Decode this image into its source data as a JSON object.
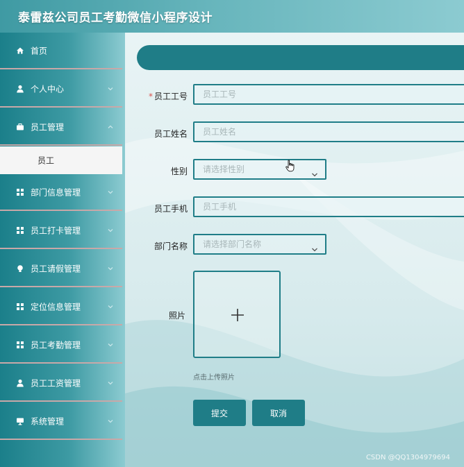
{
  "app": {
    "title": "泰雷兹公司员工考勤微信小程序设计"
  },
  "sidebar": {
    "items": [
      {
        "label": "首页",
        "icon": "home-icon"
      },
      {
        "label": "个人中心",
        "icon": "user-icon"
      },
      {
        "label": "员工管理",
        "icon": "briefcase-icon"
      },
      {
        "label": "部门信息管理",
        "icon": "grid-icon"
      },
      {
        "label": "员工打卡管理",
        "icon": "grid-icon"
      },
      {
        "label": "员工请假管理",
        "icon": "bulb-icon"
      },
      {
        "label": "定位信息管理",
        "icon": "grid-icon"
      },
      {
        "label": "员工考勤管理",
        "icon": "grid-icon"
      },
      {
        "label": "员工工资管理",
        "icon": "user-icon"
      },
      {
        "label": "系统管理",
        "icon": "monitor-icon"
      }
    ],
    "active_submenu": {
      "label": "员工"
    }
  },
  "form": {
    "employee_no": {
      "label": "员工工号",
      "required_mark": "*",
      "placeholder": "员工工号"
    },
    "employee_name": {
      "label": "员工姓名",
      "placeholder": "员工姓名"
    },
    "gender": {
      "label": "性别",
      "placeholder": "请选择性别"
    },
    "phone": {
      "label": "员工手机",
      "placeholder": "员工手机"
    },
    "department": {
      "label": "部门名称",
      "placeholder": "请选择部门名称"
    },
    "photo": {
      "label": "照片",
      "hint": "点击上传照片"
    },
    "submit_label": "提交",
    "cancel_label": "取消"
  },
  "watermark": "CSDN @QQ1304979694",
  "colors": {
    "accent": "#1f7d87",
    "sidebar": "#3d9aa3",
    "required": "#d9534f"
  }
}
